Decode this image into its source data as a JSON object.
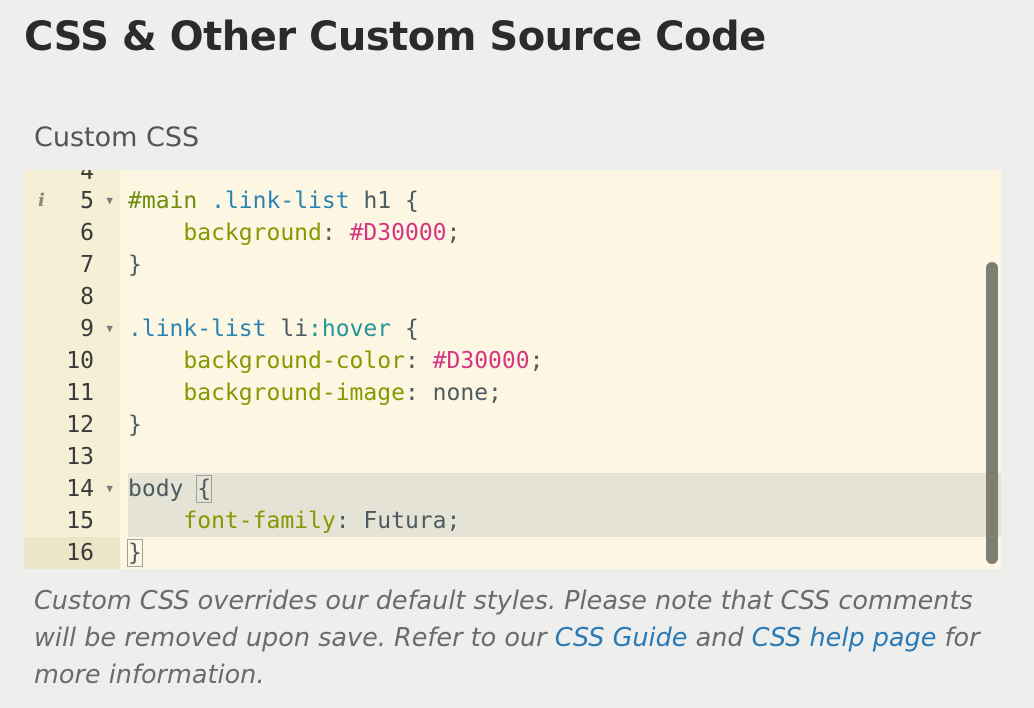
{
  "page": {
    "title": "CSS & Other Custom Source Code"
  },
  "custom_css": {
    "label": "Custom CSS",
    "editor": {
      "partial_top_line_number": "4",
      "active_line": 16,
      "lines": [
        {
          "number": "5",
          "foldable": true,
          "info": true,
          "text": "#main .link-list h1 {"
        },
        {
          "number": "6",
          "foldable": false,
          "text": "    background: #D30000;"
        },
        {
          "number": "7",
          "foldable": false,
          "text": "}"
        },
        {
          "number": "8",
          "foldable": false,
          "text": ""
        },
        {
          "number": "9",
          "foldable": true,
          "text": ".link-list li:hover {"
        },
        {
          "number": "10",
          "foldable": false,
          "text": "    background-color: #D30000;"
        },
        {
          "number": "11",
          "foldable": false,
          "text": "    background-image: none;"
        },
        {
          "number": "12",
          "foldable": false,
          "text": "}"
        },
        {
          "number": "13",
          "foldable": false,
          "text": ""
        },
        {
          "number": "14",
          "foldable": true,
          "text": "body {"
        },
        {
          "number": "15",
          "foldable": false,
          "text": "    font-family: Futura;"
        },
        {
          "number": "16",
          "foldable": false,
          "text": "}"
        }
      ],
      "icons": {
        "fold": "fold-arrow-icon",
        "info": "info-icon"
      },
      "colors": {
        "background": "#fdf6e3",
        "gutter": "#f5efd5",
        "property": "#859900",
        "class_selector": "#2a84b3",
        "id_selector": "#6c8d0e",
        "color_value": "#d33682"
      }
    },
    "help": {
      "text_1": "Custom CSS overrides our default styles. Please note that CSS comments will be removed upon save. Refer to our ",
      "link_1": "CSS Guide",
      "text_2": " and ",
      "link_2": "CSS help page",
      "text_3": " for more information."
    }
  }
}
